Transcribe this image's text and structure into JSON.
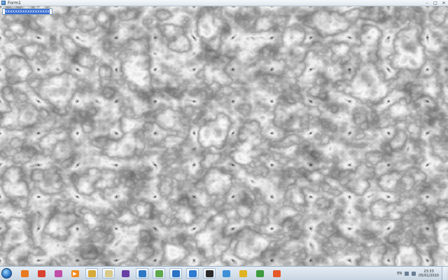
{
  "window": {
    "title": "Form1",
    "readout": "xxxxxxxxxxxxxxxxxx",
    "caption_buttons": {
      "minimize": "–",
      "maximize": "□",
      "close": "✕"
    }
  },
  "taskbar": {
    "start_icon": "windows-start-orb-icon",
    "pinned": [
      {
        "name": "firefox",
        "glyph": "",
        "color": "#e8791e",
        "active": false
      },
      {
        "name": "chrome",
        "glyph": "",
        "color": "#d94130",
        "active": false
      },
      {
        "name": "picasa",
        "glyph": "",
        "color": "#c04da8",
        "active": false
      },
      {
        "name": "media-player",
        "glyph": "▶",
        "color": "#f08b1f",
        "active": false
      },
      {
        "name": "explorer",
        "glyph": "",
        "color": "#d7a93a",
        "active": true
      },
      {
        "name": "notepad",
        "glyph": "",
        "color": "#d9c98a",
        "active": true
      },
      {
        "name": "visual-studio",
        "glyph": "",
        "color": "#6a3fa5",
        "active": false
      },
      {
        "name": "app-blue",
        "glyph": "",
        "color": "#2f78c5",
        "active": true
      },
      {
        "name": "app-green",
        "glyph": "",
        "color": "#5da84b",
        "active": true
      },
      {
        "name": "app-doc",
        "glyph": "",
        "color": "#2b73c4",
        "active": true
      },
      {
        "name": "form1",
        "glyph": "",
        "color": "#2e7bd1",
        "active": true
      },
      {
        "name": "console",
        "glyph": "",
        "color": "#2a2a2a",
        "active": true
      },
      {
        "name": "app-globe",
        "glyph": "",
        "color": "#3f8fd6",
        "active": false
      },
      {
        "name": "app-yellow",
        "glyph": "",
        "color": "#e0b323",
        "active": false
      },
      {
        "name": "app-leaf",
        "glyph": "",
        "color": "#3d9a3f",
        "active": false
      },
      {
        "name": "paint",
        "glyph": "",
        "color": "#e5592b",
        "active": false
      }
    ],
    "tray": {
      "language": "EN",
      "time": "23:33",
      "date": "05/01/2010"
    }
  }
}
